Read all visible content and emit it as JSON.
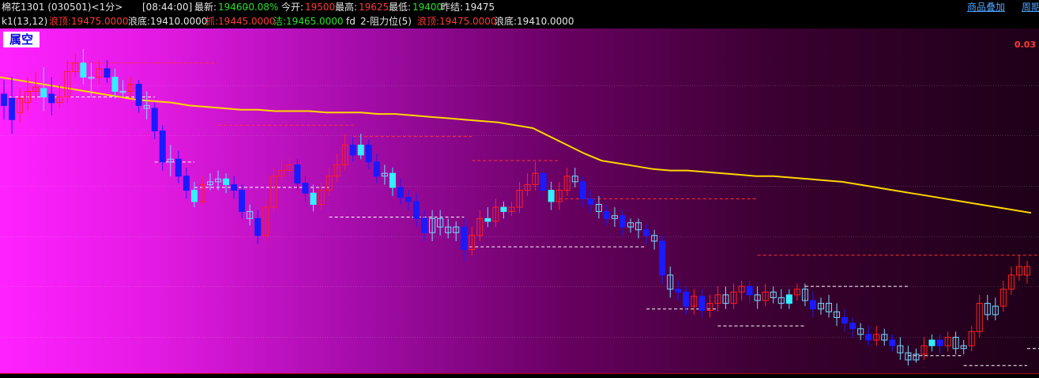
{
  "header": {
    "symbol": "棉花1301 (030501)<1分>",
    "time": "[08:44:00]",
    "latest_label": "最新:",
    "latest_value": "19460",
    "change": "-0.08%",
    "open_label": "今开:",
    "open_value": "19500",
    "high_label": "最高:",
    "high_value": "19625",
    "low_label": "最低:",
    "low_value": "19400",
    "prev_label": "昨结:",
    "prev_value": "19475",
    "overlay_link": "商品叠加",
    "period_link": "周期"
  },
  "indicator": {
    "name": "k1(13,12)",
    "top1": "浪顶:19475.0000",
    "bottom1": "浪底:19410.0000",
    "grab": "抓:19445.0000",
    "clean": "洁:19465.0000",
    "fd": "fd",
    "resistance": "2-阻力位(5)",
    "top2": "浪顶:19475.0000",
    "bottom2": "浪底:19410.0000"
  },
  "badge": "属空",
  "axis_label": "0.03",
  "colors": {
    "up": "#ff2020",
    "down_solid": "#1a1aff",
    "down_hollow": "#33f0ff",
    "ma": "#ffd600",
    "resistance": "#ff3030",
    "support": "#ffffff",
    "neutral": "#7ad7ff"
  },
  "chart_data": {
    "type": "candlestick",
    "title": "",
    "xlabel": "",
    "ylabel": "",
    "ylim": [
      19395,
      19630
    ],
    "grid": true,
    "candles": [
      [
        19588,
        19580,
        19598,
        19570,
        0
      ],
      [
        19585,
        19570,
        19600,
        19560,
        0
      ],
      [
        19575,
        19585,
        19592,
        19568,
        1
      ],
      [
        19582,
        19590,
        19600,
        19576,
        1
      ],
      [
        19590,
        19593,
        19604,
        19584,
        1
      ],
      [
        19592,
        19586,
        19607,
        19576,
        2
      ],
      [
        19588,
        19582,
        19600,
        19573,
        0
      ],
      [
        19582,
        19586,
        19595,
        19578,
        1
      ],
      [
        19586,
        19604,
        19612,
        19582,
        1
      ],
      [
        19604,
        19610,
        19617,
        19600,
        1
      ],
      [
        19610,
        19600,
        19620,
        19595,
        2
      ],
      [
        19600,
        19600,
        19610,
        19586,
        3
      ],
      [
        19600,
        19606,
        19612,
        19595,
        1
      ],
      [
        19606,
        19600,
        19612,
        19596,
        0
      ],
      [
        19600,
        19590,
        19606,
        19585,
        2
      ],
      [
        19590,
        19590,
        19598,
        19586,
        3
      ],
      [
        19590,
        19595,
        19600,
        19585,
        1
      ],
      [
        19595,
        19580,
        19598,
        19575,
        0
      ],
      [
        19580,
        19578,
        19590,
        19570,
        3
      ],
      [
        19578,
        19562,
        19582,
        19556,
        0
      ],
      [
        19562,
        19540,
        19566,
        19534,
        0
      ],
      [
        19540,
        19542,
        19552,
        19530,
        3
      ],
      [
        19542,
        19530,
        19548,
        19525,
        0
      ],
      [
        19530,
        19520,
        19536,
        19514,
        0
      ],
      [
        19520,
        19512,
        19526,
        19508,
        2
      ],
      [
        19512,
        19524,
        19530,
        19510,
        1
      ],
      [
        19524,
        19526,
        19532,
        19520,
        3
      ],
      [
        19526,
        19528,
        19534,
        19520,
        3
      ],
      [
        19528,
        19524,
        19532,
        19518,
        2
      ],
      [
        19524,
        19520,
        19530,
        19514,
        0
      ],
      [
        19520,
        19505,
        19524,
        19500,
        0
      ],
      [
        19505,
        19500,
        19510,
        19495,
        3
      ],
      [
        19500,
        19488,
        19506,
        19482,
        0
      ],
      [
        19488,
        19508,
        19514,
        19484,
        1
      ],
      [
        19508,
        19530,
        19536,
        19504,
        1
      ],
      [
        19530,
        19534,
        19542,
        19526,
        1
      ],
      [
        19534,
        19538,
        19544,
        19530,
        1
      ],
      [
        19538,
        19525,
        19542,
        19520,
        0
      ],
      [
        19525,
        19518,
        19530,
        19512,
        0
      ],
      [
        19518,
        19510,
        19524,
        19505,
        2
      ],
      [
        19510,
        19520,
        19526,
        19506,
        1
      ],
      [
        19520,
        19530,
        19536,
        19516,
        1
      ],
      [
        19530,
        19538,
        19546,
        19526,
        1
      ],
      [
        19538,
        19552,
        19560,
        19534,
        1
      ],
      [
        19552,
        19545,
        19558,
        19540,
        0
      ],
      [
        19545,
        19552,
        19560,
        19542,
        2
      ],
      [
        19552,
        19540,
        19556,
        19535,
        0
      ],
      [
        19540,
        19530,
        19546,
        19525,
        0
      ],
      [
        19530,
        19532,
        19538,
        19524,
        3
      ],
      [
        19532,
        19522,
        19536,
        19516,
        2
      ],
      [
        19522,
        19515,
        19528,
        19510,
        0
      ],
      [
        19515,
        19512,
        19520,
        19506,
        0
      ],
      [
        19512,
        19500,
        19518,
        19494,
        0
      ],
      [
        19500,
        19490,
        19506,
        19484,
        0
      ],
      [
        19490,
        19500,
        19506,
        19484,
        3
      ],
      [
        19500,
        19494,
        19506,
        19488,
        3
      ],
      [
        19494,
        19490,
        19500,
        19486,
        3
      ],
      [
        19490,
        19494,
        19498,
        19484,
        3
      ],
      [
        19494,
        19478,
        19500,
        19470,
        0
      ],
      [
        19478,
        19488,
        19494,
        19474,
        1
      ],
      [
        19488,
        19500,
        19506,
        19484,
        1
      ],
      [
        19500,
        19498,
        19508,
        19494,
        2
      ],
      [
        19498,
        19508,
        19514,
        19494,
        1
      ],
      [
        19508,
        19505,
        19512,
        19500,
        2
      ],
      [
        19505,
        19508,
        19512,
        19502,
        1
      ],
      [
        19508,
        19520,
        19526,
        19504,
        1
      ],
      [
        19520,
        19524,
        19532,
        19516,
        1
      ],
      [
        19524,
        19532,
        19540,
        19520,
        1
      ],
      [
        19532,
        19520,
        19536,
        19514,
        0
      ],
      [
        19520,
        19512,
        19526,
        19506,
        2
      ],
      [
        19512,
        19520,
        19526,
        19506,
        1
      ],
      [
        19520,
        19530,
        19536,
        19516,
        1
      ],
      [
        19530,
        19526,
        19536,
        19522,
        3
      ],
      [
        19526,
        19514,
        19530,
        19508,
        0
      ],
      [
        19514,
        19510,
        19520,
        19504,
        0
      ],
      [
        19510,
        19505,
        19516,
        19500,
        3
      ],
      [
        19505,
        19500,
        19510,
        19495,
        0
      ],
      [
        19500,
        19502,
        19508,
        19494,
        3
      ],
      [
        19502,
        19494,
        19506,
        19488,
        0
      ],
      [
        19494,
        19497,
        19500,
        19490,
        3
      ],
      [
        19497,
        19492,
        19500,
        19486,
        3
      ],
      [
        19492,
        19488,
        19496,
        19482,
        0
      ],
      [
        19488,
        19484,
        19492,
        19478,
        3
      ],
      [
        19484,
        19460,
        19488,
        19454,
        0
      ],
      [
        19460,
        19450,
        19466,
        19444,
        3
      ],
      [
        19450,
        19448,
        19456,
        19442,
        0
      ],
      [
        19448,
        19438,
        19452,
        19432,
        0
      ],
      [
        19438,
        19445,
        19450,
        19432,
        1
      ],
      [
        19445,
        19435,
        19450,
        19430,
        0
      ],
      [
        19435,
        19440,
        19446,
        19430,
        1
      ],
      [
        19440,
        19446,
        19452,
        19434,
        1
      ],
      [
        19446,
        19440,
        19452,
        19436,
        3
      ],
      [
        19440,
        19448,
        19454,
        19436,
        1
      ],
      [
        19448,
        19452,
        19456,
        19442,
        1
      ],
      [
        19452,
        19446,
        19456,
        19440,
        0
      ],
      [
        19446,
        19442,
        19452,
        19436,
        3
      ],
      [
        19442,
        19448,
        19454,
        19438,
        1
      ],
      [
        19448,
        19444,
        19452,
        19440,
        3
      ],
      [
        19444,
        19440,
        19450,
        19436,
        3
      ],
      [
        19440,
        19446,
        19450,
        19436,
        2
      ],
      [
        19446,
        19450,
        19454,
        19442,
        1
      ],
      [
        19450,
        19442,
        19454,
        19438,
        3
      ],
      [
        19442,
        19436,
        19448,
        19430,
        0
      ],
      [
        19436,
        19440,
        19444,
        19432,
        3
      ],
      [
        19440,
        19434,
        19446,
        19430,
        3
      ],
      [
        19434,
        19430,
        19440,
        19424,
        3
      ],
      [
        19430,
        19426,
        19436,
        19420,
        0
      ],
      [
        19426,
        19422,
        19430,
        19416,
        0
      ],
      [
        19422,
        19418,
        19426,
        19414,
        3
      ],
      [
        19418,
        19414,
        19424,
        19410,
        0
      ],
      [
        19414,
        19418,
        19424,
        19410,
        1
      ],
      [
        19418,
        19414,
        19422,
        19410,
        3
      ],
      [
        19414,
        19410,
        19418,
        19406,
        0
      ],
      [
        19410,
        19405,
        19416,
        19400,
        3
      ],
      [
        19405,
        19400,
        19410,
        19396,
        3
      ],
      [
        19400,
        19404,
        19408,
        19398,
        3
      ],
      [
        19404,
        19410,
        19416,
        19400,
        1
      ],
      [
        19410,
        19414,
        19418,
        19406,
        2
      ],
      [
        19414,
        19410,
        19418,
        19404,
        0
      ],
      [
        19410,
        19416,
        19420,
        19406,
        1
      ],
      [
        19416,
        19408,
        19420,
        19404,
        3
      ],
      [
        19408,
        19410,
        19414,
        19404,
        3
      ],
      [
        19410,
        19420,
        19424,
        19406,
        1
      ],
      [
        19420,
        19440,
        19446,
        19416,
        1
      ],
      [
        19440,
        19432,
        19446,
        19428,
        3
      ],
      [
        19432,
        19438,
        19444,
        19428,
        3
      ],
      [
        19438,
        19450,
        19456,
        19434,
        1
      ],
      [
        19450,
        19460,
        19466,
        19446,
        1
      ],
      [
        19460,
        19466,
        19474,
        19456,
        1
      ],
      [
        19466,
        19460,
        19470,
        19454,
        1
      ]
    ],
    "ma": [
      19600,
      19598,
      19596,
      19594,
      19592,
      19590,
      19588,
      19586,
      19584,
      19583,
      19582,
      19580,
      19579,
      19578,
      19577,
      19577,
      19576,
      19576,
      19576,
      19575,
      19575,
      19575,
      19574,
      19574,
      19573,
      19572,
      19571,
      19570,
      19569,
      19568,
      19566,
      19564,
      19558,
      19552,
      19546,
      19541,
      19539,
      19537,
      19535,
      19534,
      19534,
      19533,
      19532,
      19531,
      19530,
      19530,
      19529,
      19528,
      19527,
      19526,
      19524,
      19522,
      19520,
      19518,
      19516,
      19514,
      19512,
      19510,
      19508,
      19506,
      19504
    ],
    "resistance": [
      {
        "x0": 8,
        "x1": 27,
        "y": 19610
      },
      {
        "x0": 27,
        "x1": 44,
        "y": 19566
      },
      {
        "x0": 44,
        "x1": 59,
        "y": 19558
      },
      {
        "x0": 59,
        "x1": 70,
        "y": 19541
      },
      {
        "x0": 70,
        "x1": 95,
        "y": 19514
      },
      {
        "x0": 95,
        "x1": 134,
        "y": 19474
      }
    ],
    "support": [
      {
        "x0": 0,
        "x1": 19,
        "y": 19586
      },
      {
        "x0": 19,
        "x1": 24,
        "y": 19540
      },
      {
        "x0": 24,
        "x1": 41,
        "y": 19522
      },
      {
        "x0": 41,
        "x1": 58,
        "y": 19501
      },
      {
        "x0": 58,
        "x1": 81,
        "y": 19480
      },
      {
        "x0": 81,
        "x1": 90,
        "y": 19436
      },
      {
        "x0": 90,
        "x1": 101,
        "y": 19424
      },
      {
        "x0": 101,
        "x1": 114,
        "y": 19452
      },
      {
        "x0": 114,
        "x1": 121,
        "y": 19403
      },
      {
        "x0": 121,
        "x1": 129,
        "y": 19396
      },
      {
        "x0": 129,
        "x1": 134,
        "y": 19408
      }
    ]
  }
}
